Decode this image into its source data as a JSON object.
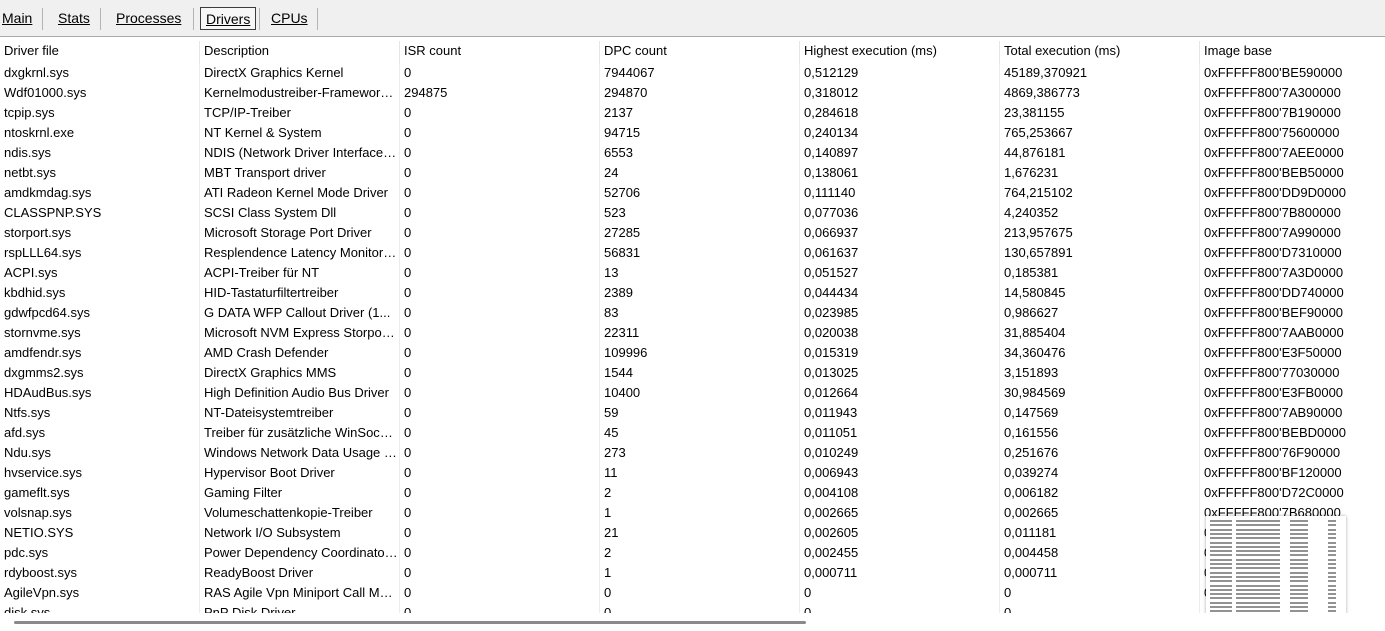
{
  "tabs": [
    "Main",
    "Stats",
    "Processes",
    "Drivers",
    "CPUs"
  ],
  "active_tab": "Drivers",
  "columns": [
    "Driver file",
    "Description",
    "ISR count",
    "DPC count",
    "Highest execution (ms)",
    "Total execution (ms)",
    "Image base"
  ],
  "rows": [
    [
      "dxgkrnl.sys",
      "DirectX Graphics Kernel",
      "0",
      "7944067",
      "0,512129",
      "45189,370921",
      "0xFFFFF800'BE590000"
    ],
    [
      "Wdf01000.sys",
      "Kernelmodustreiber-Framework-Laufzeit",
      "294875",
      "294870",
      "0,318012",
      "4869,386773",
      "0xFFFFF800'7A300000"
    ],
    [
      "tcpip.sys",
      "TCP/IP-Treiber",
      "0",
      "2137",
      "0,284618",
      "23,381155",
      "0xFFFFF800'7B190000"
    ],
    [
      "ntoskrnl.exe",
      "NT Kernel & System",
      "0",
      "94715",
      "0,240134",
      "765,253667",
      "0xFFFFF800'75600000"
    ],
    [
      "ndis.sys",
      "NDIS (Network Driver Interface Specification)",
      "0",
      "6553",
      "0,140897",
      "44,876181",
      "0xFFFFF800'7AEE0000"
    ],
    [
      "netbt.sys",
      "MBT Transport driver",
      "0",
      "24",
      "0,138061",
      "1,676231",
      "0xFFFFF800'BEB50000"
    ],
    [
      "amdkmdag.sys",
      "ATI Radeon Kernel Mode Driver",
      "0",
      "52706",
      "0,111140",
      "764,215102",
      "0xFFFFF800'DD9D0000"
    ],
    [
      "CLASSPNP.SYS",
      "SCSI Class System Dll",
      "0",
      "523",
      "0,077036",
      "4,240352",
      "0xFFFFF800'7B800000"
    ],
    [
      "storport.sys",
      "Microsoft Storage Port Driver",
      "0",
      "27285",
      "0,066937",
      "213,957675",
      "0xFFFFF800'7A990000"
    ],
    [
      "rspLLL64.sys",
      "Resplendence Latency Monitoring Driver",
      "0",
      "56831",
      "0,061637",
      "130,657891",
      "0xFFFFF800'D7310000"
    ],
    [
      "ACPI.sys",
      "ACPI-Treiber für NT",
      "0",
      "13",
      "0,051527",
      "0,185381",
      "0xFFFFF800'7A3D0000"
    ],
    [
      "kbdhid.sys",
      "HID-Tastaturfiltertreiber",
      "0",
      "2389",
      "0,044434",
      "14,580845",
      "0xFFFFF800'DD740000"
    ],
    [
      "gdwfpcd64.sys",
      "G DATA WFP Callout Driver (1...",
      "0",
      "83",
      "0,023985",
      "0,986627",
      "0xFFFFF800'BEF90000"
    ],
    [
      "stornvme.sys",
      "Microsoft NVM Express Storport Miniport",
      "0",
      "22311",
      "0,020038",
      "31,885404",
      "0xFFFFF800'7AAB0000"
    ],
    [
      "amdfendr.sys",
      "AMD Crash Defender",
      "0",
      "109996",
      "0,015319",
      "34,360476",
      "0xFFFFF800'E3F50000"
    ],
    [
      "dxgmms2.sys",
      "DirectX Graphics MMS",
      "0",
      "1544",
      "0,013025",
      "3,151893",
      "0xFFFFF800'77030000"
    ],
    [
      "HDAudBus.sys",
      "High Definition Audio Bus Driver",
      "0",
      "10400",
      "0,012664",
      "30,984569",
      "0xFFFFF800'E3FB0000"
    ],
    [
      "Ntfs.sys",
      "NT-Dateisystemtreiber",
      "0",
      "59",
      "0,011943",
      "0,147569",
      "0xFFFFF800'7AB90000"
    ],
    [
      "afd.sys",
      "Treiber für zusätzliche WinSock-Funktionen",
      "0",
      "45",
      "0,011051",
      "0,161556",
      "0xFFFFF800'BEBD0000"
    ],
    [
      "Ndu.sys",
      "Windows Network Data Usage Monitoring Driver",
      "0",
      "273",
      "0,010249",
      "0,251676",
      "0xFFFFF800'76F90000"
    ],
    [
      "hvservice.sys",
      "Hypervisor Boot Driver",
      "0",
      "11",
      "0,006943",
      "0,039274",
      "0xFFFFF800'BF120000"
    ],
    [
      "gameflt.sys",
      "Gaming Filter",
      "0",
      "2",
      "0,004108",
      "0,006182",
      "0xFFFFF800'D72C0000"
    ],
    [
      "volsnap.sys",
      "Volumeschattenkopie-Treiber",
      "0",
      "1",
      "0,002665",
      "0,002665",
      "0xFFFFF800'7B680000"
    ],
    [
      "NETIO.SYS",
      "Network I/O Subsystem",
      "0",
      "21",
      "0,002605",
      "0,011181",
      "0"
    ],
    [
      "pdc.sys",
      "Power Dependency Coordinator Driver",
      "0",
      "2",
      "0,002455",
      "0,004458",
      "0"
    ],
    [
      "rdyboost.sys",
      "ReadyBoost Driver",
      "0",
      "1",
      "0,000711",
      "0,000711",
      "0"
    ],
    [
      "AgileVpn.sys",
      "RAS Agile Vpn Miniport Call Manager",
      "0",
      "0",
      "0",
      "0",
      "0"
    ],
    [
      "disk.sys",
      "PnP Disk Driver",
      "0",
      "0",
      "0",
      "0",
      ""
    ]
  ]
}
